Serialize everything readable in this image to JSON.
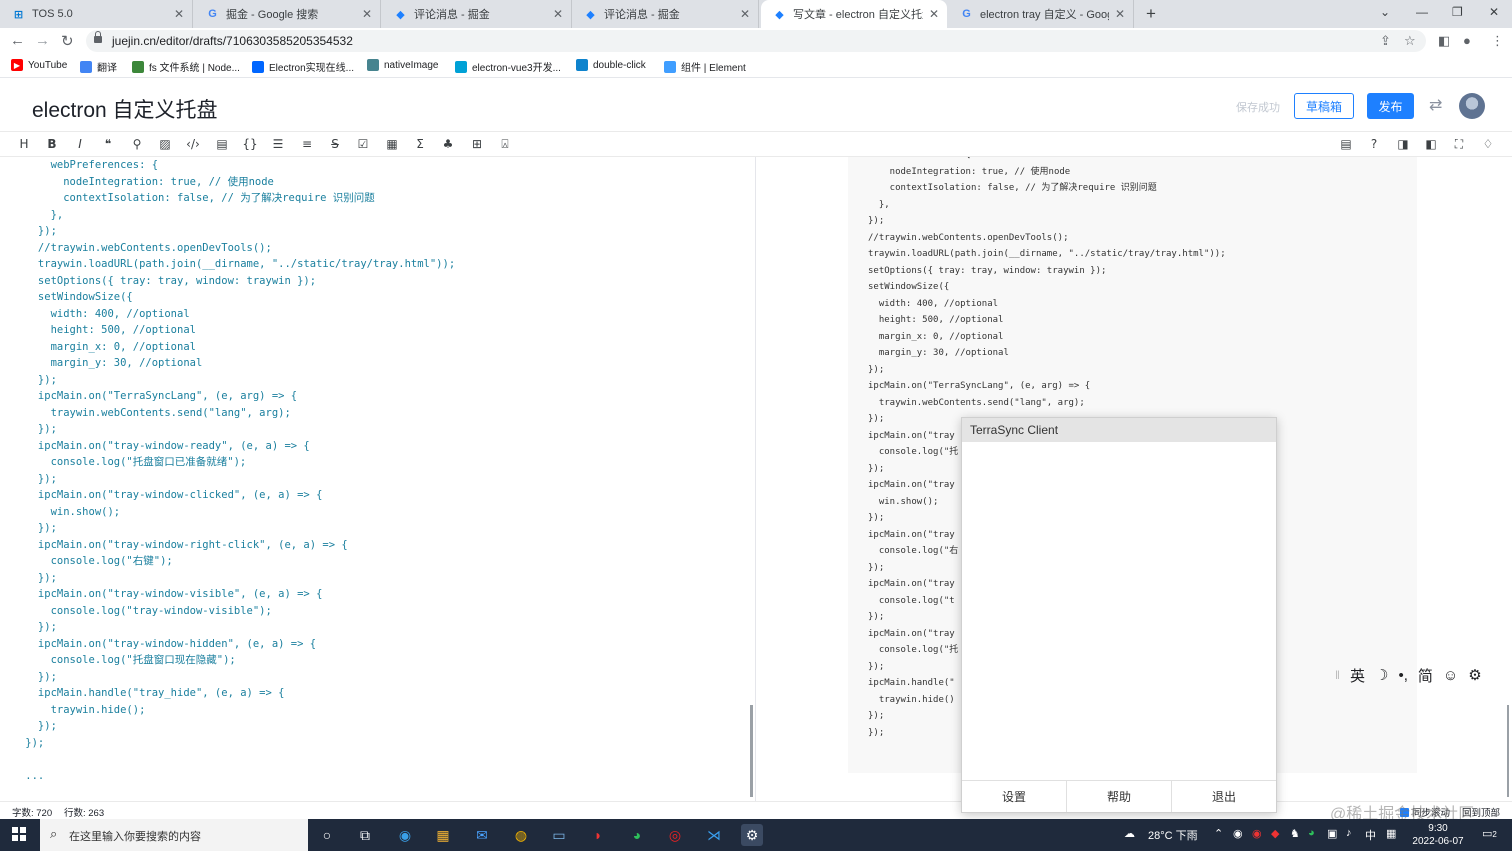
{
  "browser": {
    "tabs": [
      {
        "title": "TOS 5.0",
        "active": false,
        "icon": "windows-icon",
        "color": "#0078d4"
      },
      {
        "title": "掘金 - Google 搜索",
        "active": false,
        "icon": "google-icon",
        "color": "#4285f4"
      },
      {
        "title": "评论消息 - 掘金",
        "active": false,
        "icon": "juejin-icon",
        "color": "#1e80ff"
      },
      {
        "title": "评论消息 - 掘金",
        "active": false,
        "icon": "juejin-icon",
        "color": "#1e80ff"
      },
      {
        "title": "写文章 - electron 自定义托盘 - 稀",
        "active": true,
        "icon": "juejin-icon",
        "color": "#1e80ff"
      },
      {
        "title": "electron tray 自定义 - Google 搜索",
        "active": false,
        "icon": "google-icon",
        "color": "#4285f4"
      }
    ],
    "url": "juejin.cn/editor/drafts/7106303585205354532",
    "bookmarks": [
      {
        "label": "YouTube",
        "icon": "youtube-icon",
        "color": "#ff0000"
      },
      {
        "label": "翻译",
        "icon": "translate-icon",
        "color": "#4285f4"
      },
      {
        "label": "fs 文件系统 | Node...",
        "icon": "nodejs-icon",
        "color": "#3c873a"
      },
      {
        "label": "Electron实现在线...",
        "icon": "zhihu-icon",
        "color": "#0066ff"
      },
      {
        "label": "nativeImage",
        "icon": "electron-icon",
        "color": "#47848f"
      },
      {
        "label": "electron-vue3开发...",
        "icon": "bilibili-icon",
        "color": "#00a1d6"
      },
      {
        "label": "double-click",
        "icon": "hexo-icon",
        "color": "#0e83cd"
      },
      {
        "label": "组件 | Element",
        "icon": "element-icon",
        "color": "#409eff"
      }
    ]
  },
  "editor": {
    "title": "electron 自定义托盘",
    "save_status": "保存成功",
    "draft_label": "草稿箱",
    "publish_label": "发布",
    "code": "        webPreferences: {\n          nodeIntegration: true, // 使用node\n          contextIsolation: false, // 为了解决require 识别问题\n        },\n      });\n      //traywin.webContents.openDevTools();\n      traywin.loadURL(path.join(__dirname, \"../static/tray/tray.html\"));\n      setOptions({ tray: tray, window: traywin });\n      setWindowSize({\n        width: 400, //optional\n        height: 500, //optional\n        margin_x: 0, //optional\n        margin_y: 30, //optional\n      });\n      ipcMain.on(\"TerraSyncLang\", (e, arg) => {\n        traywin.webContents.send(\"lang\", arg);\n      });\n      ipcMain.on(\"tray-window-ready\", (e, a) => {\n        console.log(\"托盘窗口已准备就绪\");\n      });\n      ipcMain.on(\"tray-window-clicked\", (e, a) => {\n        win.show();\n      });\n      ipcMain.on(\"tray-window-right-click\", (e, a) => {\n        console.log(\"右键\");\n      });\n      ipcMain.on(\"tray-window-visible\", (e, a) => {\n        console.log(\"tray-window-visible\");\n      });\n      ipcMain.on(\"tray-window-hidden\", (e, a) => {\n        console.log(\"托盘窗口现在隐藏\");\n      });\n      ipcMain.handle(\"tray_hide\", (e, a) => {\n        traywin.hide();\n      });\n    });\n\n    ...",
    "preview_code": "  webPreferences: {\n    nodeIntegration: true, // 使用node\n    contextIsolation: false, // 为了解决require 识别问题\n  },\n});\n//traywin.webContents.openDevTools();\ntraywin.loadURL(path.join(__dirname, \"../static/tray/tray.html\"));\nsetOptions({ tray: tray, window: traywin });\nsetWindowSize({\n  width: 400, //optional\n  height: 500, //optional\n  margin_x: 0, //optional\n  margin_y: 30, //optional\n});\nipcMain.on(\"TerraSyncLang\", (e, arg) => {\n  traywin.webContents.send(\"lang\", arg);\n});\nipcMain.on(\"tray\n  console.log(\"托\n});\nipcMain.on(\"tray\n  win.show();\n});\nipcMain.on(\"tray\n  console.log(\"右\n});\nipcMain.on(\"tray\n  console.log(\"t\n});\nipcMain.on(\"tray\n  console.log(\"托\n});\nipcMain.handle(\"\n  traywin.hide()\n});\n});",
    "word_count": "字数: 720",
    "line_count": "行数: 263",
    "sync_scroll": "同步滚动",
    "back_to_top": "回到顶部",
    "watermark": "@稀土掘金技术社区"
  },
  "ime": {
    "lang": "英",
    "moon": "☽",
    "punct": "•,",
    "mode": "简",
    "emoji": "☺",
    "settings": "⚙"
  },
  "popup": {
    "title": "TerraSync Client",
    "buttons": [
      "设置",
      "帮助",
      "退出"
    ]
  },
  "taskbar": {
    "search_placeholder": "在这里输入你要搜索的内容",
    "weather": "28°C 下雨",
    "ime_lang": "中",
    "time": "9:30",
    "date": "2022-06-07",
    "notifications": "2"
  }
}
